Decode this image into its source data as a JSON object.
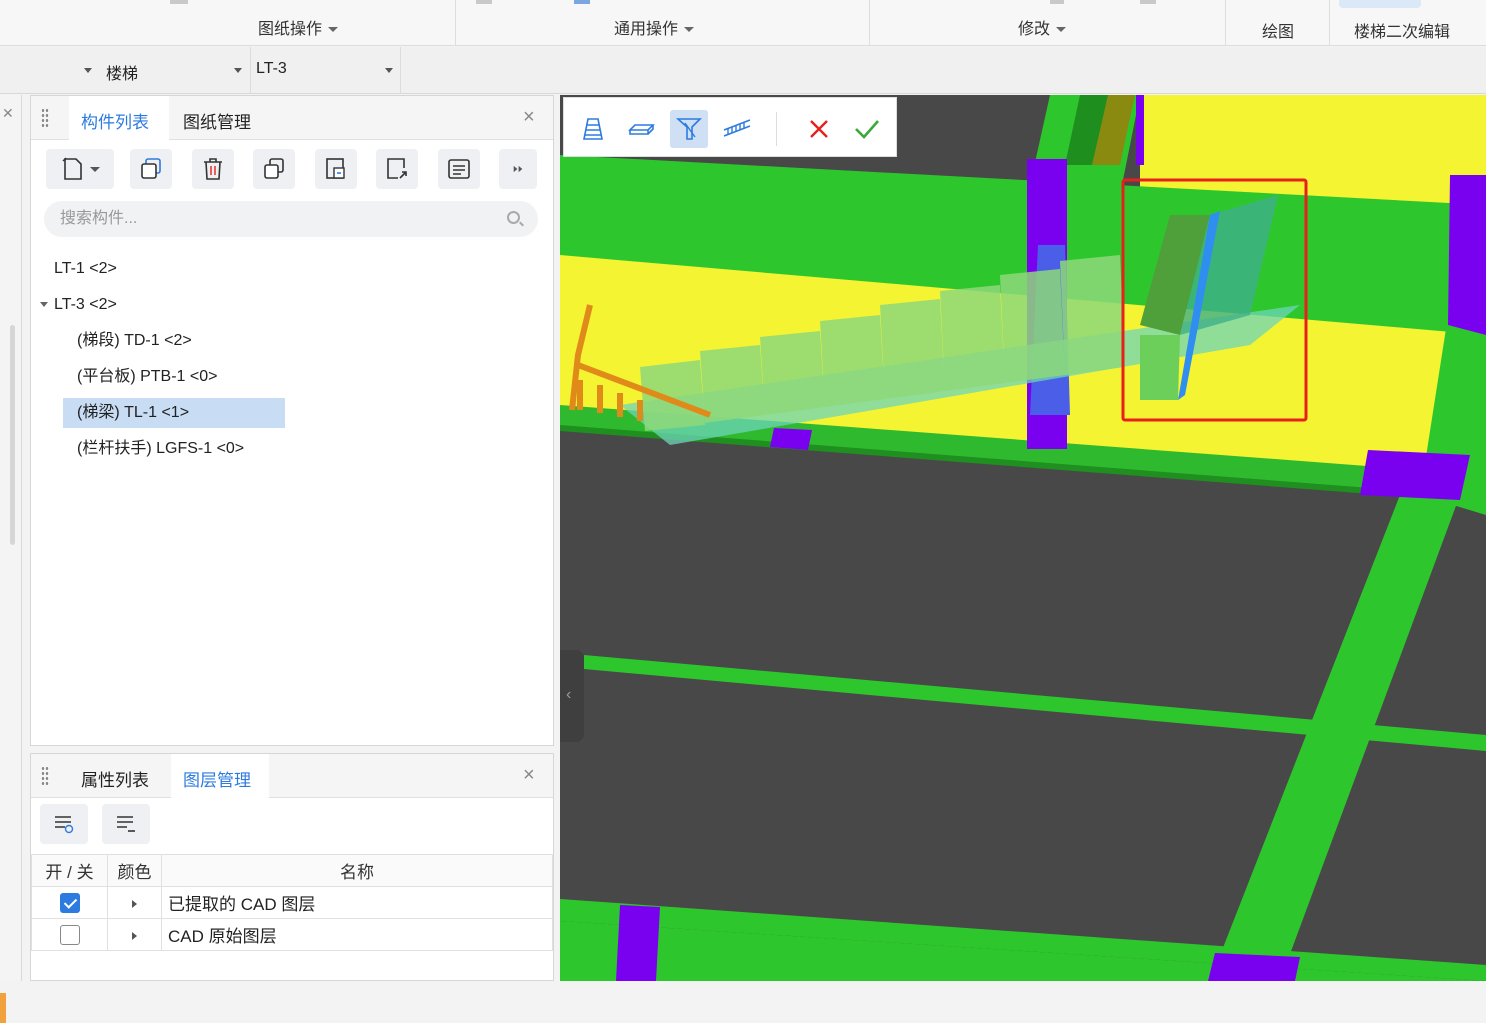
{
  "ribbon": {
    "groups": [
      {
        "label": "图纸操作"
      },
      {
        "label": "通用操作"
      },
      {
        "label": "修改"
      },
      {
        "label": "绘图"
      },
      {
        "label": "楼梯二次编辑"
      }
    ]
  },
  "selectors": {
    "category": "楼梯",
    "component": "LT-3"
  },
  "component_panel": {
    "tabs": [
      "构件列表",
      "图纸管理"
    ],
    "active_tab": "构件列表",
    "search_placeholder": "搜索构件...",
    "tools": [
      "new-icon",
      "copy-icon",
      "delete-icon",
      "layer-copy-icon",
      "import-icon",
      "export-icon",
      "list-icon",
      "more-icon"
    ],
    "tree": [
      {
        "label": "LT-1 <2>",
        "level": 0
      },
      {
        "label": "LT-3 <2>",
        "level": 0,
        "expanded": true
      },
      {
        "label": "(梯段) TD-1 <2>",
        "level": 1
      },
      {
        "label": "(平台板) PTB-1 <0>",
        "level": 1
      },
      {
        "label": "(梯梁) TL-1 <1>",
        "level": 1,
        "selected": true
      },
      {
        "label": "(栏杆扶手) LGFS-1 <0>",
        "level": 1
      }
    ]
  },
  "layer_panel": {
    "tabs": [
      "属性列表",
      "图层管理"
    ],
    "active_tab": "图层管理",
    "columns": [
      "开 / 关",
      "颜色",
      "名称"
    ],
    "rows": [
      {
        "on": true,
        "name": "已提取的 CAD 图层"
      },
      {
        "on": false,
        "name": "CAD 原始图层"
      }
    ]
  },
  "viewport_toolbar": {
    "tools": [
      "stair-run-icon",
      "platform-icon",
      "stair-beam-icon",
      "railing-icon",
      "cancel-icon",
      "confirm-icon"
    ],
    "active": "stair-beam-icon"
  },
  "colors": {
    "accent": "#2d7be0",
    "beam_green": "#2dc72d",
    "slab_yellow": "#f5f535",
    "column_purple": "#7a00f0",
    "highlight_red": "#e8201c"
  }
}
